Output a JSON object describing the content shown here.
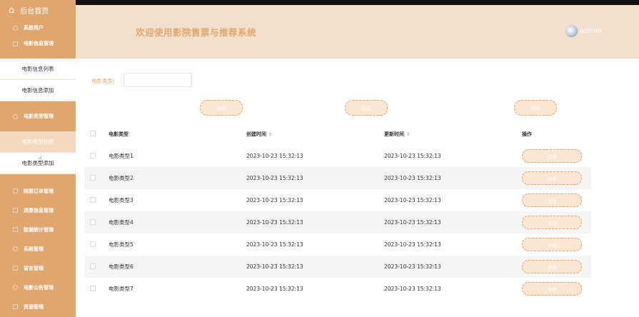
{
  "sidebar": {
    "home_label": "后台首页",
    "home_icon": "home-icon",
    "menus": [
      {
        "label": "系统用户",
        "icon": "gear-icon"
      },
      {
        "label": "电影信息管理",
        "icon": "list-icon"
      }
    ],
    "movie_info_subs": [
      "电影信息列表",
      "电影信息添加"
    ],
    "movie_type_menu": {
      "label": "电影类型管理",
      "icon": "settings-icon"
    },
    "movie_type_subs": [
      "电影类型列表",
      "电影类型添加"
    ],
    "active_sub": "电影类型列表",
    "lower_menus": [
      {
        "label": "购票订单管理",
        "icon": "order-icon"
      },
      {
        "label": "退票信息管理",
        "icon": "ticket-icon"
      },
      {
        "label": "数据统计管理",
        "icon": "chart-icon"
      },
      {
        "label": "系统管理",
        "icon": "gear-icon"
      },
      {
        "label": "留言管理",
        "icon": "message-icon"
      },
      {
        "label": "电影公告管理",
        "icon": "notice-icon"
      },
      {
        "label": "资源管理",
        "icon": "resource-icon"
      }
    ]
  },
  "header": {
    "title": "欢迎使用影院售票与推荐系统",
    "username": "admin"
  },
  "search": {
    "label": "电影类型:",
    "value": "",
    "placeholder": ""
  },
  "buttons": {
    "search": "查询",
    "reset": "重置",
    "delete": "删除"
  },
  "table": {
    "headers": {
      "type": "电影类型",
      "created": "创建时间",
      "updated": "更新时间",
      "ops": "操作"
    },
    "detail_label": "详情",
    "rows": [
      {
        "type": "电影类型1",
        "created": "2023-10-23 15:32:13",
        "updated": "2023-10-23 15:32:13"
      },
      {
        "type": "电影类型2",
        "created": "2023-10-23 15:32:13",
        "updated": "2023-10-23 15:32:13"
      },
      {
        "type": "电影类型3",
        "created": "2023-10-23 15:32:13",
        "updated": "2023-10-23 15:32:13"
      },
      {
        "type": "电影类型4",
        "created": "2023-10-23 15:32:13",
        "updated": "2023-10-23 15:32:13"
      },
      {
        "type": "电影类型5",
        "created": "2023-10-23 15:32:13",
        "updated": "2023-10-23 15:32:13"
      },
      {
        "type": "电影类型6",
        "created": "2023-10-23 15:32:13",
        "updated": "2023-10-23 15:32:13"
      },
      {
        "type": "电影类型7",
        "created": "2023-10-23 15:32:13",
        "updated": "2023-10-23 15:32:13"
      }
    ]
  },
  "colors": {
    "accent": "#e0a66e",
    "header_bg": "#f2dfcc",
    "button_bg": "#fbe5d3"
  }
}
